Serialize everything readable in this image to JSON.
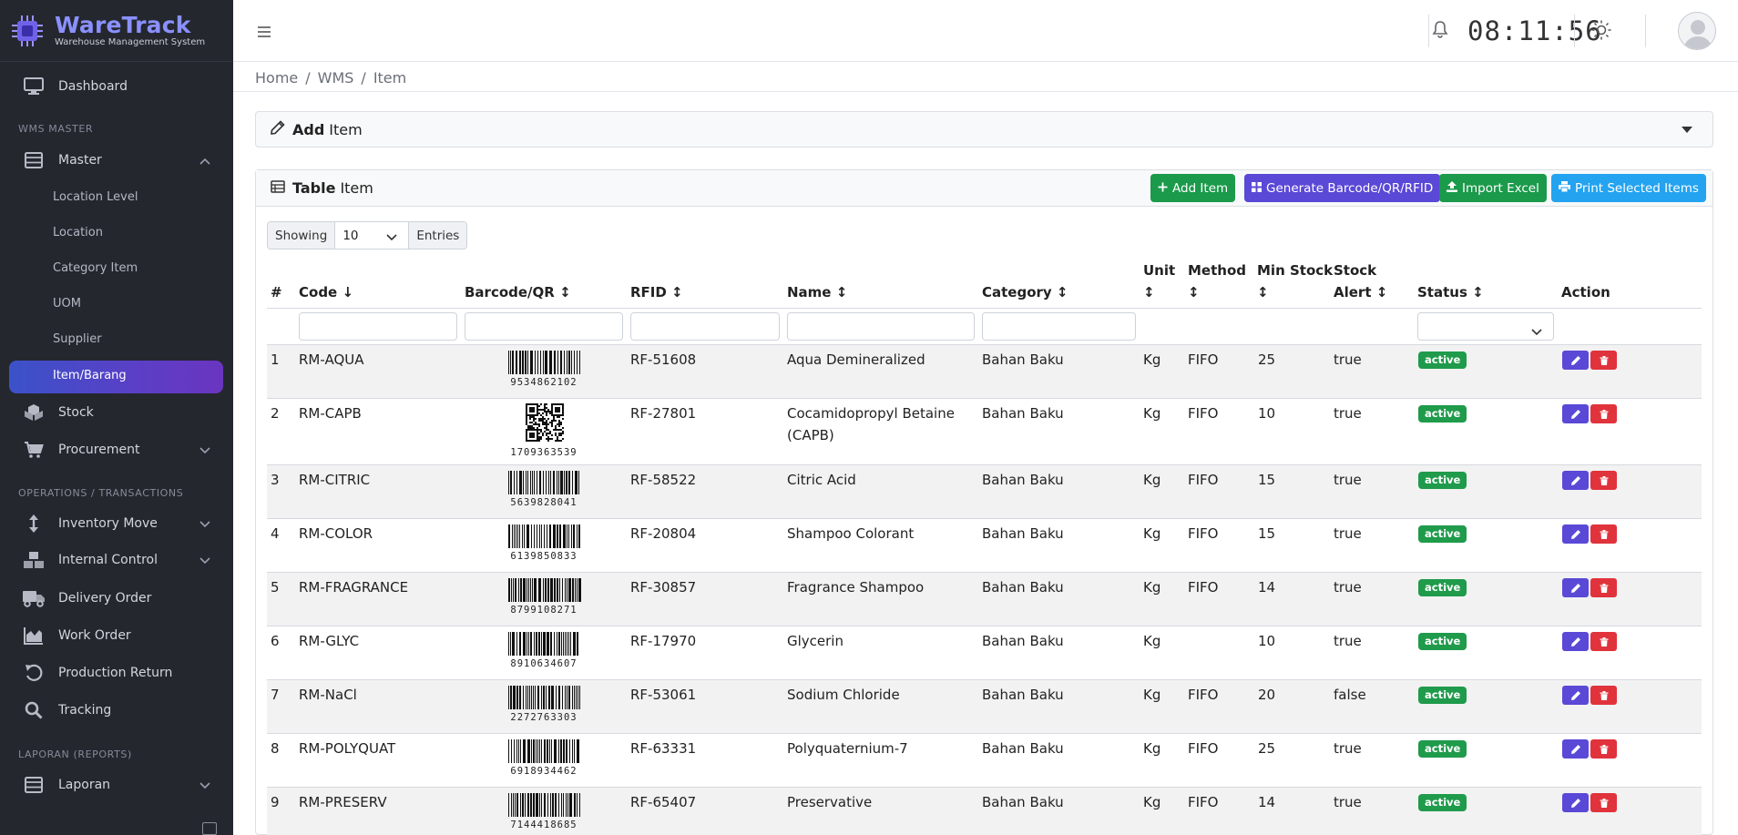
{
  "brand": {
    "name": "WareTrack",
    "subtitle": "Warehouse Management System"
  },
  "sidebar": {
    "dashboard": "Dashboard",
    "section_master": "WMS MASTER",
    "master": "Master",
    "master_items": [
      "Location Level",
      "Location",
      "Category Item",
      "UOM",
      "Supplier",
      "Item/Barang"
    ],
    "stock": "Stock",
    "procurement": "Procurement",
    "section_ops": "OPERATIONS / TRANSACTIONS",
    "inventory_move": "Inventory Move",
    "internal_control": "Internal Control",
    "delivery_order": "Delivery Order",
    "work_order": "Work Order",
    "production_return": "Production Return",
    "tracking": "Tracking",
    "section_reports": "LAPORAN (REPORTS)",
    "laporan": "Laporan"
  },
  "topbar": {
    "clock": "08:11:56"
  },
  "breadcrumb": {
    "home": "Home",
    "sep": "/",
    "wms": "WMS",
    "item": "Item"
  },
  "add_panel": {
    "bold": "Add",
    "rest": "Item"
  },
  "table_panel": {
    "bold": "Table",
    "rest": "Item"
  },
  "buttons": {
    "add": "Add Item",
    "generate": "Generate Barcode/QR/RFID",
    "import": "Import Excel",
    "print": "Print Selected Items"
  },
  "length": {
    "showing": "Showing",
    "value": "10",
    "entries": "Entries"
  },
  "columns": {
    "num": "#",
    "code": "Code ↓",
    "barcode": "Barcode/QR ↕",
    "rfid": "RFID ↕",
    "name": "Name ↕",
    "category": "Category ↕",
    "unit_1": "Unit",
    "unit_2": "↕",
    "method_1": "Method",
    "method_2": "↕",
    "min_1": "Min Stock",
    "min_2": "↕",
    "alert_1": "Stock",
    "alert_2": "Alert ↕",
    "status": "Status ↕",
    "action": "Action"
  },
  "rows": [
    {
      "num": "1",
      "code": "RM-AQUA",
      "bc_type": "barcode",
      "bc": "9534862102",
      "rfid": "RF-51608",
      "name": "Aqua Demineralized",
      "name2": "",
      "category": "Bahan Baku",
      "unit": "Kg",
      "method": "FIFO",
      "min": "25",
      "alert": "true",
      "status": "active"
    },
    {
      "num": "2",
      "code": "RM-CAPB",
      "bc_type": "qr",
      "bc": "1709363539",
      "rfid": "RF-27801",
      "name": "Cocamidopropyl Betaine",
      "name2": "(CAPB)",
      "category": "Bahan Baku",
      "unit": "Kg",
      "method": "FIFO",
      "min": "10",
      "alert": "true",
      "status": "active"
    },
    {
      "num": "3",
      "code": "RM-CITRIC",
      "bc_type": "barcode",
      "bc": "5639828041",
      "rfid": "RF-58522",
      "name": "Citric Acid",
      "name2": "",
      "category": "Bahan Baku",
      "unit": "Kg",
      "method": "FIFO",
      "min": "15",
      "alert": "true",
      "status": "active"
    },
    {
      "num": "4",
      "code": "RM-COLOR",
      "bc_type": "barcode",
      "bc": "6139850833",
      "rfid": "RF-20804",
      "name": "Shampoo Colorant",
      "name2": "",
      "category": "Bahan Baku",
      "unit": "Kg",
      "method": "FIFO",
      "min": "15",
      "alert": "true",
      "status": "active"
    },
    {
      "num": "5",
      "code": "RM-FRAGRANCE",
      "bc_type": "barcode",
      "bc": "8799108271",
      "rfid": "RF-30857",
      "name": "Fragrance Shampoo",
      "name2": "",
      "category": "Bahan Baku",
      "unit": "Kg",
      "method": "FIFO",
      "min": "14",
      "alert": "true",
      "status": "active"
    },
    {
      "num": "6",
      "code": "RM-GLYC",
      "bc_type": "barcode",
      "bc": "8910634607",
      "rfid": "RF-17970",
      "name": "Glycerin",
      "name2": "",
      "category": "Bahan Baku",
      "unit": "Kg",
      "method": "",
      "min": "10",
      "alert": "true",
      "status": "active"
    },
    {
      "num": "7",
      "code": "RM-NaCl",
      "bc_type": "barcode",
      "bc": "2272763303",
      "rfid": "RF-53061",
      "name": "Sodium Chloride",
      "name2": "",
      "category": "Bahan Baku",
      "unit": "Kg",
      "method": "FIFO",
      "min": "20",
      "alert": "false",
      "status": "active"
    },
    {
      "num": "8",
      "code": "RM-POLYQUAT",
      "bc_type": "barcode",
      "bc": "6918934462",
      "rfid": "RF-63331",
      "name": "Polyquaternium-7",
      "name2": "",
      "category": "Bahan Baku",
      "unit": "Kg",
      "method": "FIFO",
      "min": "25",
      "alert": "true",
      "status": "active"
    },
    {
      "num": "9",
      "code": "RM-PRESERV",
      "bc_type": "barcode",
      "bc": "7144418685",
      "rfid": "RF-65407",
      "name": "Preservative",
      "name2": "",
      "category": "Bahan Baku",
      "unit": "Kg",
      "method": "FIFO",
      "min": "14",
      "alert": "true",
      "status": "active"
    }
  ],
  "icons": {
    "brand": "chip-icon",
    "dashboard": "monitor-icon",
    "master": "list-icon",
    "stock": "cubes-icon",
    "procurement": "cart-icon",
    "inventory_move": "arrows-vertical-icon",
    "internal_control": "boxes-icon",
    "delivery_order": "truck-icon",
    "work_order": "chart-area-icon",
    "production_return": "undo-icon",
    "tracking": "search-icon",
    "laporan": "list-icon",
    "bell": "bell-icon",
    "theme": "sun-icon"
  },
  "colors": {
    "sidebar_bg": "#25272f",
    "brand": "#8a91ff",
    "green": "#1a9a4a",
    "purple": "#5a48d6",
    "blue": "#23a3f0",
    "red": "#e0333c"
  }
}
